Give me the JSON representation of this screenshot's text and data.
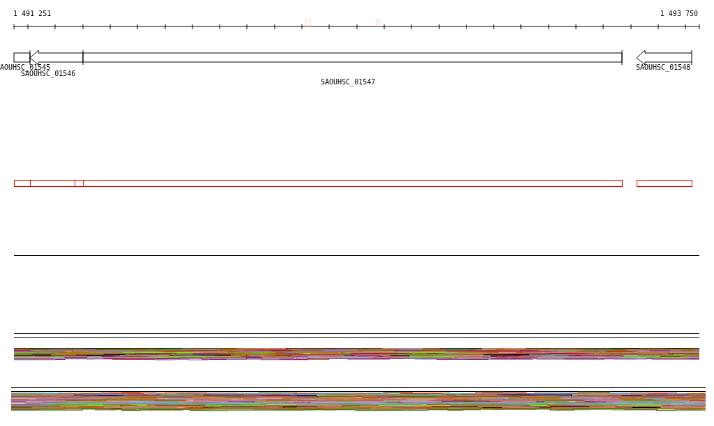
{
  "ruler": {
    "start_label": "1 491 251",
    "end_label": "1 493 750"
  },
  "genes": [
    {
      "label": "AOUHSC_01545",
      "kind": "box"
    },
    {
      "label": "SAOUHSC_01546",
      "kind": "arrow"
    },
    {
      "label": "SAOUHSC_01547",
      "kind": "box"
    },
    {
      "label": "SAOUHSC_01548",
      "kind": "arrow"
    }
  ]
}
